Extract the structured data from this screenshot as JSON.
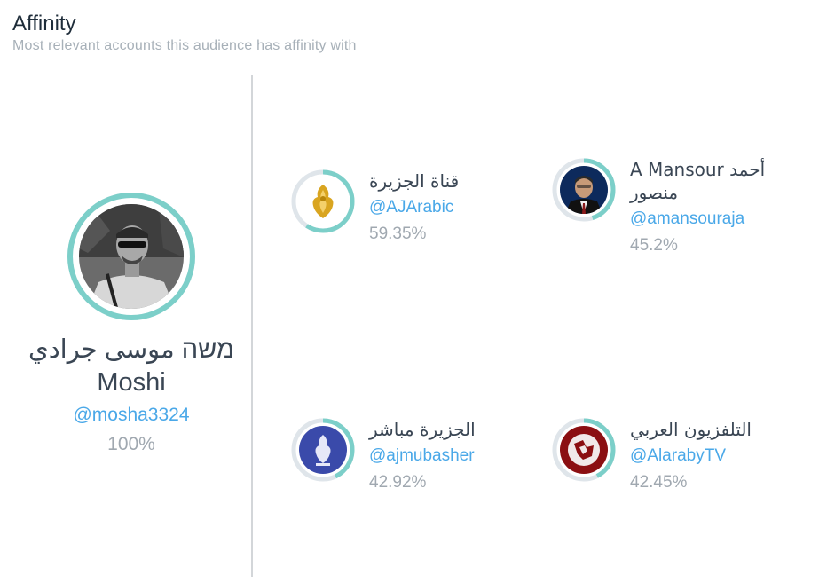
{
  "header": {
    "title": "Affinity",
    "subtitle": "Most relevant accounts this audience has affinity with"
  },
  "colors": {
    "ring_track": "#dfe5ea",
    "ring_fill": "#7ccfc9",
    "handle": "#4aa8e8",
    "percent": "#a0a8b0"
  },
  "main_profile": {
    "name_line1": "משה موسى جرادي",
    "name_line2": "Moshi",
    "handle": "@mosha3324",
    "percent": "100%",
    "affinity": 1.0
  },
  "accounts": [
    {
      "name": "قناة الجزيرة",
      "handle": "@AJArabic",
      "percent": "59.35%",
      "affinity": 0.5935,
      "icon": "al-jazeera-gold-logo-icon"
    },
    {
      "name": "A Mansour أحمد منصور",
      "handle": "@amansouraja",
      "percent": "45.2%",
      "affinity": 0.452,
      "icon": "avatar-man-suit-icon"
    },
    {
      "name": "الجزيرة مباشر",
      "handle": "@ajmubasher",
      "percent": "42.92%",
      "affinity": 0.4292,
      "icon": "al-jazeera-mubasher-logo-icon"
    },
    {
      "name": "التلفزيون العربي",
      "handle": "@AlarabyTV",
      "percent": "42.45%",
      "affinity": 0.4245,
      "icon": "alaraby-tv-logo-icon"
    }
  ]
}
